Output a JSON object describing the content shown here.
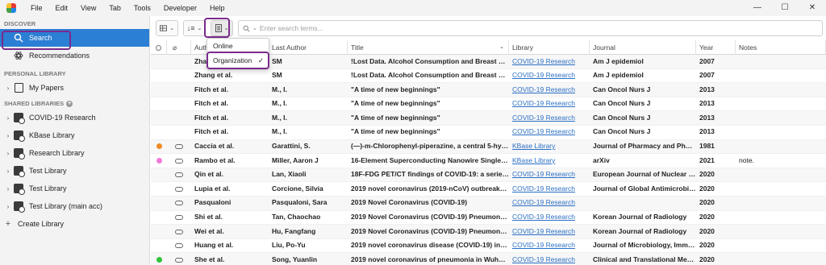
{
  "menubar": {
    "items": [
      "File",
      "Edit",
      "View",
      "Tab",
      "Tools",
      "Developer",
      "Help"
    ]
  },
  "window_controls": {
    "minimize": "—",
    "maximize": "☐",
    "close": "✕"
  },
  "sidebar": {
    "discover_header": "DISCOVER",
    "search_label": "Search",
    "recommendations_label": "Recommendations",
    "personal_header": "PERSONAL LIBRARY",
    "my_papers_label": "My Papers",
    "shared_header": "SHARED LIBRARIES",
    "shared_libraries": [
      {
        "label": "COVID-19 Research"
      },
      {
        "label": "KBase Library"
      },
      {
        "label": "Research Library"
      },
      {
        "label": "Test Library"
      },
      {
        "label": "Test Library"
      },
      {
        "label": "Test Library (main acc)"
      }
    ],
    "create_library_label": "Create Library"
  },
  "search": {
    "placeholder": "Enter search terms..."
  },
  "dropdown": {
    "items": [
      {
        "label": "Online"
      },
      {
        "label": "Organization",
        "check": "✓"
      }
    ]
  },
  "table": {
    "headers": {
      "authors": "Auth",
      "last_author": "Last Author",
      "title": "Title",
      "library": "Library",
      "journal": "Journal",
      "year": "Year",
      "notes": "Notes"
    },
    "rows": [
      {
        "authors": "Zhang et al.",
        "last": "SM",
        "title": "!Lost Data. Alcohol Consumption and Breast Canc...",
        "library": "COVID-19 Research",
        "journal": "Am J epidemiol",
        "year": "2007",
        "notes": "",
        "dot": "",
        "cloud": false
      },
      {
        "authors": "Zhang et al.",
        "last": "SM",
        "title": "!Lost Data. Alcohol Consumption and Breast Canc...",
        "library": "COVID-19 Research",
        "journal": "Am J epidemiol",
        "year": "2007",
        "notes": "",
        "dot": "",
        "cloud": false
      },
      {
        "authors": "Fitch et al.",
        "last": "M., I.",
        "title": "\"A time of new beginnings\"",
        "library": "COVID-19 Research",
        "journal": "Can Oncol Nurs J",
        "year": "2013",
        "notes": "",
        "dot": "",
        "cloud": false
      },
      {
        "authors": "Fitch et al.",
        "last": "M., I.",
        "title": "\"A time of new beginnings\"",
        "library": "COVID-19 Research",
        "journal": "Can Oncol Nurs J",
        "year": "2013",
        "notes": "",
        "dot": "",
        "cloud": false
      },
      {
        "authors": "Fitch et al.",
        "last": "M., I.",
        "title": "\"A time of new beginnings\"",
        "library": "COVID-19 Research",
        "journal": "Can Oncol Nurs J",
        "year": "2013",
        "notes": "",
        "dot": "",
        "cloud": false
      },
      {
        "authors": "Fitch et al.",
        "last": "M., I.",
        "title": "\"A time of new beginnings\"",
        "library": "COVID-19 Research",
        "journal": "Can Oncol Nurs J",
        "year": "2013",
        "notes": "",
        "dot": "",
        "cloud": false
      },
      {
        "authors": "Caccia et al.",
        "last": "Garattini, S.",
        "title": "(—)-m-Chlorophenyl-piperazine, a central 5-hydr...",
        "library": "KBase Library",
        "journal": "Journal of Pharmacy and Pharm...",
        "year": "1981",
        "notes": "",
        "dot": "#f08a24",
        "cloud": true
      },
      {
        "authors": "Rambo et al.",
        "last": "Miller, Aaron J",
        "title": "16-Element Superconducting Nanowire Single-Ph...",
        "library": "KBase Library",
        "journal": "arXiv",
        "year": "2021",
        "notes": "note.",
        "dot": "#f07ad8",
        "cloud": true
      },
      {
        "authors": "Qin et al.",
        "last": "Lan, Xiaoli",
        "title": "18F-FDG PET/CT findings of COVID-19: a series of...",
        "library": "COVID-19 Research",
        "journal": "European Journal of Nuclear M...",
        "year": "2020",
        "notes": "",
        "dot": "",
        "cloud": true
      },
      {
        "authors": "Lupia et al.",
        "last": "Corcione, Silvia",
        "title": "2019 novel coronavirus (2019-nCoV) outbreak: A ...",
        "library": "COVID-19 Research",
        "journal": "Journal of Global Antimicrobial ...",
        "year": "2020",
        "notes": "",
        "dot": "",
        "cloud": true
      },
      {
        "authors": "Pasqualoni",
        "last": "Pasqualoni, Sara",
        "title": "2019 Novel Coronavirus (COVID-19)",
        "library": "COVID-19 Research",
        "journal": "",
        "year": "2020",
        "notes": "",
        "dot": "",
        "cloud": true
      },
      {
        "authors": "Shi et al.",
        "last": "Tan, Chaochao",
        "title": "2019 Novel Coronavirus (COVID-19) Pneumonia ...",
        "library": "COVID-19 Research",
        "journal": "Korean Journal of Radiology",
        "year": "2020",
        "notes": "",
        "dot": "",
        "cloud": true
      },
      {
        "authors": "Wei et al.",
        "last": "Hu, Fangfang",
        "title": "2019 Novel Coronavirus (COVID-19) Pneumonia ...",
        "library": "COVID-19 Research",
        "journal": "Korean Journal of Radiology",
        "year": "2020",
        "notes": "",
        "dot": "",
        "cloud": true
      },
      {
        "authors": "Huang et al.",
        "last": "Liu, Po-Yu",
        "title": "2019 novel coronavirus disease (COVID-19) in Tai...",
        "library": "COVID-19 Research",
        "journal": "Journal of Microbiology, Immu...",
        "year": "2020",
        "notes": "",
        "dot": "",
        "cloud": true
      },
      {
        "authors": "She et al.",
        "last": "Song, Yuanlin",
        "title": "2019 novel coronavirus of pneumonia in Wuhan, ...",
        "library": "COVID-19 Research",
        "journal": "Clinical and Translational Medic...",
        "year": "2020",
        "notes": "",
        "dot": "#2ec23a",
        "cloud": true
      }
    ]
  },
  "colors": {
    "accent": "#2b7fd4",
    "highlight": "#7a2a8c",
    "link": "#2b6fc4"
  }
}
